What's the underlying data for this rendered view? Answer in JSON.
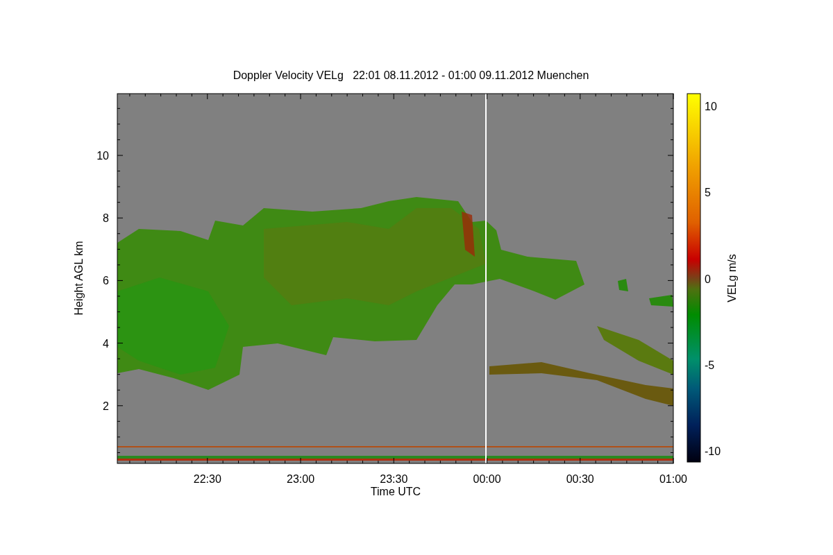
{
  "title": "Doppler Velocity VELg   22:01 08.11.2012 - 01:00 09.11.2012 Muenchen",
  "plot": {
    "xlabel": "Time UTC",
    "ylabel": "Height AGL km",
    "xticks": [
      "22:30",
      "23:00",
      "23:30",
      "00:00",
      "00:30",
      "01:00"
    ],
    "yticks": [
      "10",
      "8",
      "6",
      "4",
      "2"
    ]
  },
  "colorbar": {
    "label": "VELg m/s",
    "ticks": [
      "10",
      "5",
      "0",
      "-5",
      "-10"
    ]
  }
}
